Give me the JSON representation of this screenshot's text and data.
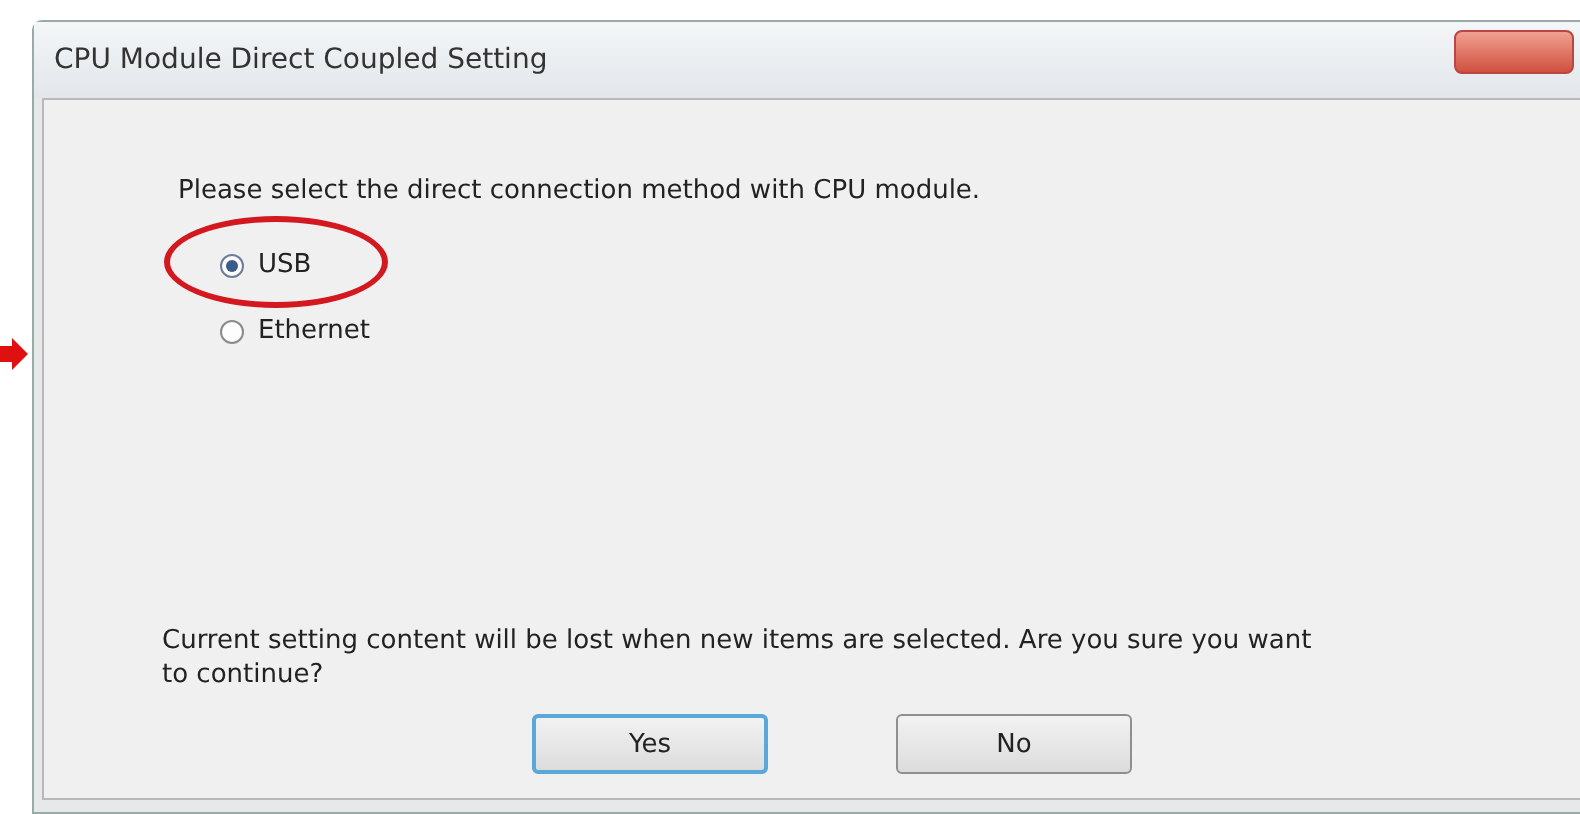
{
  "window": {
    "title": "CPU Module Direct Coupled Setting"
  },
  "prompt": "Please select the direct connection method with CPU module.",
  "options": [
    {
      "label": "USB",
      "selected": true,
      "highlighted": true
    },
    {
      "label": "Ethernet",
      "selected": false,
      "highlighted": false
    }
  ],
  "warning": "Current setting content will be lost when new items are selected. Are you sure you want to continue?",
  "buttons": [
    {
      "label": "Yes",
      "focused": true
    },
    {
      "label": "No",
      "focused": false
    }
  ]
}
